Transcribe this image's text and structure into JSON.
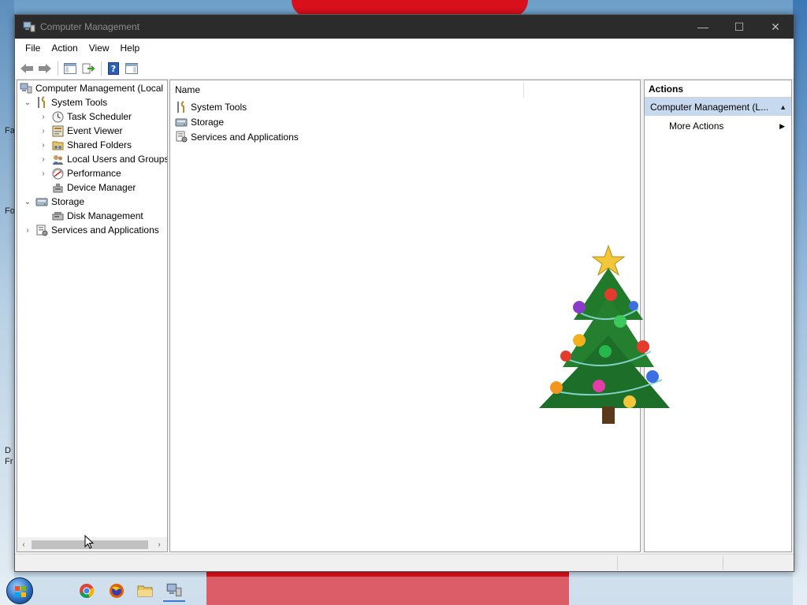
{
  "window": {
    "title": "Computer Management",
    "minimize_glyph": "—",
    "maximize_glyph": "☐",
    "close_glyph": "✕"
  },
  "menu": [
    "File",
    "Action",
    "View",
    "Help"
  ],
  "toolbar": [
    "back-icon",
    "forward-icon",
    "show-hide-console-tree-icon",
    "export-list-icon",
    "help-icon",
    "show-hide-action-pane-icon"
  ],
  "tree": {
    "root": "Computer Management (Local",
    "system_tools": "System Tools",
    "task_scheduler": "Task Scheduler",
    "event_viewer": "Event Viewer",
    "shared_folders": "Shared Folders",
    "local_users": "Local Users and Groups",
    "performance": "Performance",
    "device_manager": "Device Manager",
    "storage": "Storage",
    "disk_management": "Disk Management",
    "services_apps": "Services and Applications"
  },
  "list": {
    "column_name": "Name",
    "rows": [
      "System Tools",
      "Storage",
      "Services and Applications"
    ]
  },
  "actions": {
    "header": "Actions",
    "section": "Computer Management (L...",
    "more_actions": "More Actions"
  },
  "desktop": {
    "labels": [
      "Fa",
      "Fo",
      "D",
      "Fr"
    ]
  },
  "colors": {
    "titlebar": "#2b2b2b",
    "action_section": "#c7d9ee",
    "desktop_red": "#d8101c"
  }
}
